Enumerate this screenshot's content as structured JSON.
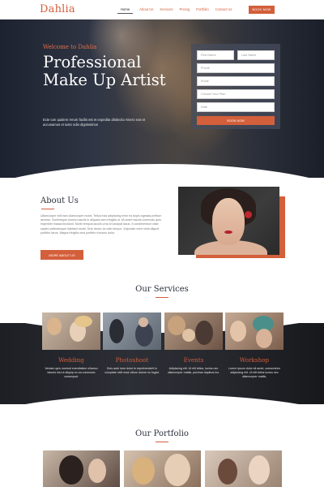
{
  "nav": {
    "logo": "Dahlia",
    "items": [
      {
        "label": "Home",
        "active": true
      },
      {
        "label": "About Us",
        "active": false
      },
      {
        "label": "Services",
        "active": false
      },
      {
        "label": "Pricing",
        "active": false
      },
      {
        "label": "Portfolio",
        "active": false
      },
      {
        "label": "Contact Us",
        "active": false
      }
    ],
    "book_button": "BOOK NOW"
  },
  "hero": {
    "welcome": "Welcome to Dahlia",
    "title": "Professional Make Up Artist",
    "text": "Ecte ium quidem rerum facilis est et expedita distinctio Alvero eos et accusamus et iusto odio dignissimos",
    "form": {
      "first_name_placeholder": "First Name",
      "last_name_placeholder": "Last Name",
      "phone_placeholder": "Phone",
      "email_placeholder": "Email",
      "plan_placeholder": "Choose Your Plan",
      "date_placeholder": "Date",
      "submit_label": "BOOK NOW"
    }
  },
  "about": {
    "title": "About Us",
    "text": "Ullamcorper velit sed ullamcorper morbi. Tellus mas adipiscing enim eu turpis egestas pretium aenean. Scelerisque viverra mauris in aliquam sem fringilla ut. Mi amet mauris commodo quis imperdiet massa tincidunt. Morbi tempus iaculis urna id volutpat lacus. It condimentum vitae sapien pellentesque habitant morbi. Duis donec ac odio tempor. Vulputate enim nulla aliquet porttitor lacus. Magna fringilla urna porttitor rhoncus dolor.",
    "button": "MORE ABOUT US"
  },
  "services": {
    "title": "Our Services",
    "cards": [
      {
        "title": "Wedding",
        "text": "Veniam quis nostrud exercitation ullamco laboris nisi ut aliquip ex ea commodo consequat."
      },
      {
        "title": "Photoshoot",
        "text": "Duis aute irure dolor in reprehenderit in voluptate velit esse cillum dolore eu fugiat."
      },
      {
        "title": "Events",
        "text": "Adipiscing elit. Ut elit tellus, luctus nec ullamcorper mattis, pulvinar dapibus leo."
      },
      {
        "title": "Workshop",
        "text": "Lorem ipsum dolor sit amet, consectetur adipiscing elit. Ut elit tellus luctus nec ullamcorper mattis."
      }
    ]
  },
  "portfolio": {
    "title": "Our Portfolio"
  },
  "colors": {
    "accent": "#d35f3b",
    "dark": "#2a2f3a"
  }
}
